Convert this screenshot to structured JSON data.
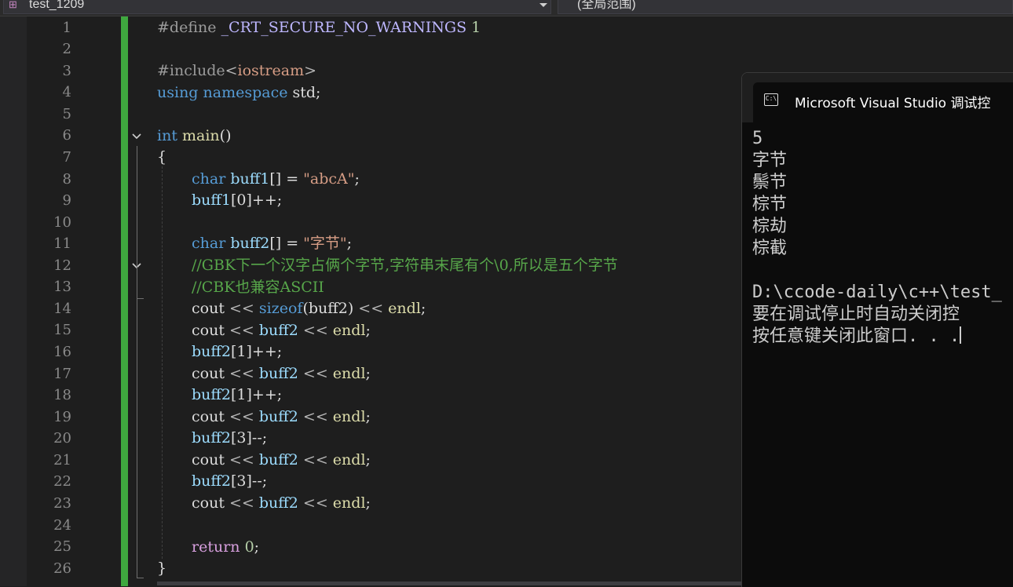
{
  "toolbar": {
    "project_dropdown": "test_1209",
    "scope_dropdown": "(全局范围)"
  },
  "editor": {
    "line_numbers": [
      "1",
      "2",
      "3",
      "4",
      "5",
      "6",
      "7",
      "8",
      "9",
      "10",
      "11",
      "12",
      "13",
      "14",
      "15",
      "16",
      "17",
      "18",
      "19",
      "20",
      "21",
      "22",
      "23",
      "24",
      "25",
      "26"
    ],
    "code": {
      "l1_directive": "#define ",
      "l1_macro": "_CRT_SECURE_NO_WARNINGS",
      "l1_value": " 1",
      "l3_directive": "#include",
      "l3_header_open": "<",
      "l3_header": "iostream",
      "l3_header_close": ">",
      "l4_using": "using",
      "l4_namespace_kw": "namespace",
      "l4_std": " std;",
      "l6_type": "int",
      "l6_main": "main",
      "l6_parens": "()",
      "l7_brace": "{",
      "l8_type": "char",
      "l8_var": "buff1",
      "l8_rest": "[] = ",
      "l8_str": "\"abcA\"",
      "l8_semi": ";",
      "l9_var": "buff1",
      "l9_rest": "[0]++;",
      "l11_type": "char",
      "l11_var": "buff2",
      "l11_rest": "[] = ",
      "l11_str": "\"字节\"",
      "l11_semi": ";",
      "l12_comment": "//GBK下一个汉字占俩个字节,字符串末尾有个\\0,所以是五个字节",
      "l13_comment": "//CBK也兼容ASCII",
      "l14_cout": "cout",
      "l14_op1": " << ",
      "l14_sizeof": "sizeof",
      "l14_arg": "(buff2)",
      "l14_op2": " << ",
      "l14_endl": "endl",
      "l14_semi": ";",
      "cout": "cout",
      "shl": " << ",
      "buff2": "buff2",
      "endl": "endl",
      "semi": ";",
      "l16_rest": "[1]++;",
      "l18_rest": "[1]++;",
      "l20_rest": "[3]--;",
      "l22_rest": "[3]--;",
      "l25_return": "return",
      "l25_value": " 0",
      "l25_semi": ";",
      "l26_brace": "}"
    }
  },
  "console": {
    "title": "Microsoft Visual Studio 调试控",
    "close_label": "✕",
    "icon_label": "C:\\",
    "lines": [
      "5",
      "字节",
      "鬃节",
      "棕节",
      "棕劫",
      "棕截",
      "",
      "D:\\ccode-daily\\c++\\test_",
      "要在调试停止时自动关闭控",
      "按任意键关闭此窗口. . ."
    ]
  },
  "colors": {
    "editor_bg": "#1e1e1e",
    "change_bar": "#3fa83f",
    "keyword": "#569cd6",
    "string": "#d69d85",
    "comment": "#57a64a",
    "console_bg": "#0c0c0c"
  }
}
